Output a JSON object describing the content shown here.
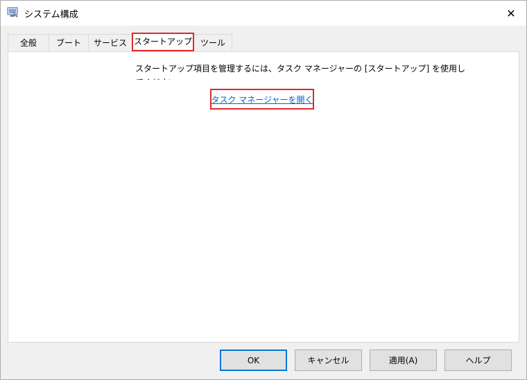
{
  "window": {
    "title": "システム構成",
    "close_glyph": "✕"
  },
  "tabs": [
    {
      "label": "全般"
    },
    {
      "label": "ブート"
    },
    {
      "label": "サービス"
    },
    {
      "label": "スタートアップ"
    },
    {
      "label": "ツール"
    }
  ],
  "startup": {
    "message": "スタートアップ項目を管理するには、タスク マネージャーの [スタートアップ] を使用してください。",
    "open_task_manager_link": "タスク マネージャーを開く"
  },
  "buttons": {
    "ok": "OK",
    "cancel": "キャンセル",
    "apply": "適用(A)",
    "help": "ヘルプ"
  },
  "colors": {
    "highlight": "#e0282b",
    "link": "#0066cc",
    "default_button_border": "#0078d7"
  }
}
